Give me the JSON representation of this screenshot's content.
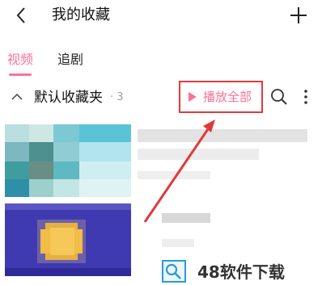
{
  "header": {
    "title": "我的收藏"
  },
  "tabs": [
    {
      "label": "视频",
      "active": true
    },
    {
      "label": "追剧",
      "active": false
    }
  ],
  "folder": {
    "name": "默认收藏夹",
    "count": "· 3",
    "play_all_label": "播放全部"
  },
  "watermark": {
    "text": "48软件下载"
  },
  "colors": {
    "accent": "#fb7299",
    "annotation_red": "#e03a3a",
    "text_primary": "#111111",
    "text_secondary": "#9a9a9a"
  },
  "icons": {
    "back": "chevron-left-icon",
    "add": "plus-icon",
    "collapse": "chevron-up-icon",
    "play": "play-triangle-icon",
    "search": "search-icon",
    "more": "more-vertical-icon"
  }
}
